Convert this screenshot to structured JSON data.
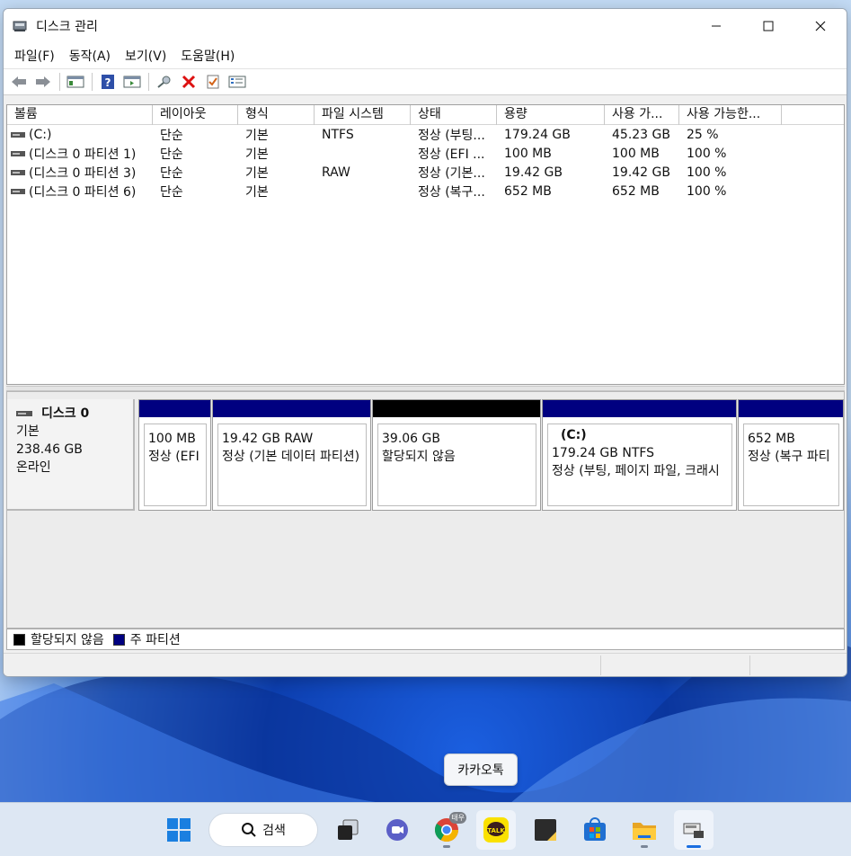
{
  "window": {
    "title": "디스크 관리",
    "minimize_icon": "minimize-icon",
    "maximize_icon": "maximize-icon",
    "close_icon": "close-icon"
  },
  "menu": [
    "파일(F)",
    "동작(A)",
    "보기(V)",
    "도움말(H)"
  ],
  "toolbar": [
    "back-arrow-icon",
    "forward-arrow-icon",
    "console-tree-icon",
    "help-icon",
    "action-pane-icon",
    "connect-icon",
    "delete-icon",
    "properties-icon",
    "list-view-icon"
  ],
  "volume_list": {
    "columns": [
      "볼륨",
      "레이아웃",
      "형식",
      "파일 시스템",
      "상태",
      "용량",
      "사용 가...",
      "사용 가능한..."
    ],
    "rows": [
      [
        "(C:)",
        "단순",
        "기본",
        "NTFS",
        "정상 (부팅...",
        "179.24 GB",
        "45.23 GB",
        "25 %"
      ],
      [
        "(디스크 0 파티션 1)",
        "단순",
        "기본",
        "",
        "정상 (EFI ...",
        "100 MB",
        "100 MB",
        "100 %"
      ],
      [
        "(디스크 0 파티션 3)",
        "단순",
        "기본",
        "RAW",
        "정상 (기본...",
        "19.42 GB",
        "19.42 GB",
        "100 %"
      ],
      [
        "(디스크 0 파티션 6)",
        "단순",
        "기본",
        "",
        "정상 (복구...",
        "652 MB",
        "652 MB",
        "100 %"
      ]
    ]
  },
  "disk": {
    "name": "디스크 0",
    "type": "기본",
    "size": "238.46 GB",
    "status": "온라인",
    "partitions": [
      {
        "title": "",
        "line1": "100 MB",
        "line2": "정상 (EFI",
        "color": "#000080"
      },
      {
        "title": "",
        "line1": "19.42 GB RAW",
        "line2": "정상 (기본 데이터 파티션)",
        "color": "#000080"
      },
      {
        "title": "",
        "line1": "39.06 GB",
        "line2": "할당되지 않음",
        "color": "#000000"
      },
      {
        "title": "(C:)",
        "line1": "179.24 GB NTFS",
        "line2": "정상 (부팅, 페이지 파일, 크래시",
        "color": "#000080"
      },
      {
        "title": "",
        "line1": "652 MB",
        "line2": "정상 (복구 파티",
        "color": "#000080"
      }
    ]
  },
  "legend": [
    {
      "label": "할당되지 않음",
      "color": "#000000"
    },
    {
      "label": "주 파티션",
      "color": "#000080"
    }
  ],
  "tooltip": "카카오톡",
  "taskbar": {
    "search_label": "검색",
    "items": [
      "windows-start-icon",
      "task-view-icon",
      "teams-chat-icon",
      "chrome-icon",
      "kakaotalk-icon",
      "sticky-notes-icon",
      "microsoft-store-icon",
      "file-explorer-icon",
      "disk-management-icon"
    ],
    "chrome_badge": "태우",
    "kakao_label": "TALK"
  }
}
